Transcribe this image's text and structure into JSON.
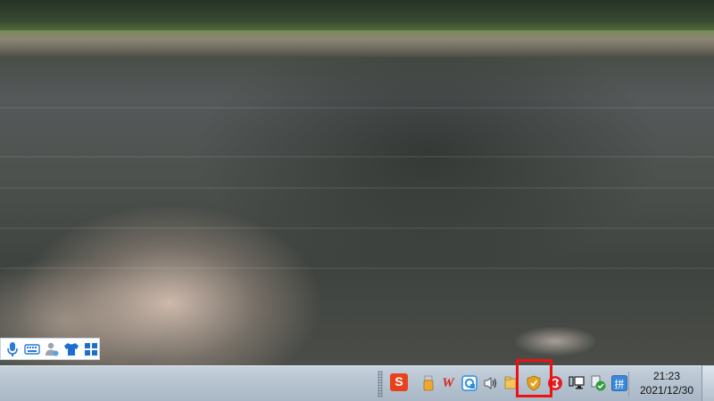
{
  "desktop": {
    "wallpaper": "river landscape"
  },
  "ime_bar": {
    "icons": [
      "microphone-icon",
      "keyboard-icon",
      "user-settings-icon",
      "skin-shirt-icon",
      "toolbox-grid-icon"
    ]
  },
  "taskbar": {
    "tray_icons": [
      "sogou-ime-icon",
      "usb-device-icon",
      "wps-office-icon",
      "sync-app-icon",
      "volume-icon",
      "notification-folder-icon",
      "security-shield-icon",
      "red-app-icon",
      "network-icon",
      "antivirus-check-icon",
      "input-method-icon"
    ],
    "sogou_label": "S",
    "wps_label": "W",
    "ime_label": "拼",
    "clock": {
      "time": "21:23",
      "date": "2021/12/30"
    },
    "highlighted_icon": "security-shield-icon",
    "highlight_color": "#ee1111",
    "accent_color": "#e8a020"
  }
}
